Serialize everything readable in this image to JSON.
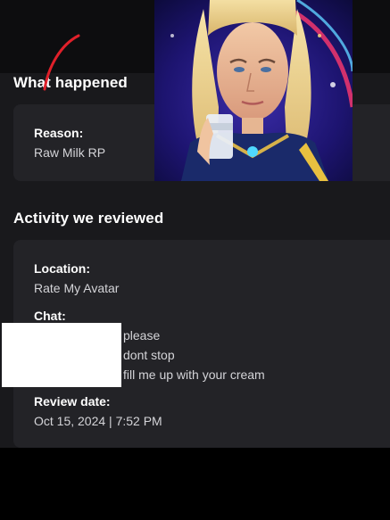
{
  "what_happened": {
    "heading": "What happened",
    "reason_label": "Reason:",
    "reason_value": "Raw Milk RP"
  },
  "activity": {
    "heading": "Activity we reviewed",
    "location_label": "Location:",
    "location_value": "Rate My Avatar",
    "chat_label": "Chat:",
    "chat_lines": [
      "please",
      "dont stop",
      "fill me up with your cream"
    ],
    "review_date_label": "Review date:",
    "review_date_value": "Oct 15, 2024 | 7:52 PM"
  },
  "colors": {
    "background": "#19191c",
    "card": "#232327",
    "annotation": "#e0202a"
  }
}
